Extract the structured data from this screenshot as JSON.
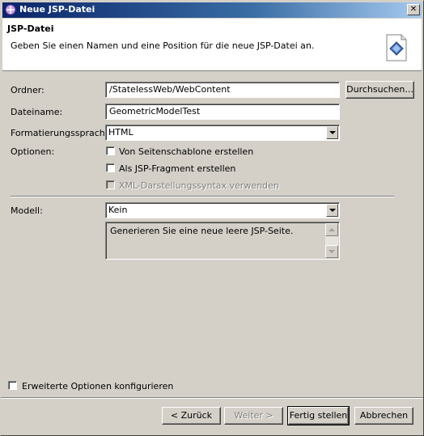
{
  "window": {
    "title": "Neue JSP-Datei",
    "close_glyph": "✕"
  },
  "banner": {
    "title": "JSP-Datei",
    "description": "Geben Sie einen Namen und eine Position für die neue JSP-Datei an.",
    "icon": "jsp-file-icon"
  },
  "form": {
    "folder": {
      "label": "Ordner:",
      "value": "/StatelessWeb/WebContent",
      "browse": "Durchsuchen..."
    },
    "filename": {
      "label": "Dateiname:",
      "value": "GeometricModelTest"
    },
    "markup": {
      "label": "Formatierungssprache:",
      "value": "HTML"
    },
    "options": {
      "label": "Optionen:",
      "items": [
        {
          "label": "Von Seitenschablone erstellen",
          "checked": false,
          "enabled": true
        },
        {
          "label": "Als JSP-Fragment erstellen",
          "checked": false,
          "enabled": true
        },
        {
          "label": "XML-Darstellungssyntax verwenden",
          "checked": false,
          "enabled": false
        }
      ]
    },
    "model": {
      "label": "Modell:",
      "value": "Kein",
      "description": "Generieren Sie eine neue leere JSP-Seite."
    },
    "advanced": {
      "label": "Erweiterte Optionen konfigurieren",
      "checked": false
    }
  },
  "buttons": {
    "back": "< Zurück",
    "next": "Weiter >",
    "finish": "Fertig stellen",
    "cancel": "Abbrechen"
  }
}
